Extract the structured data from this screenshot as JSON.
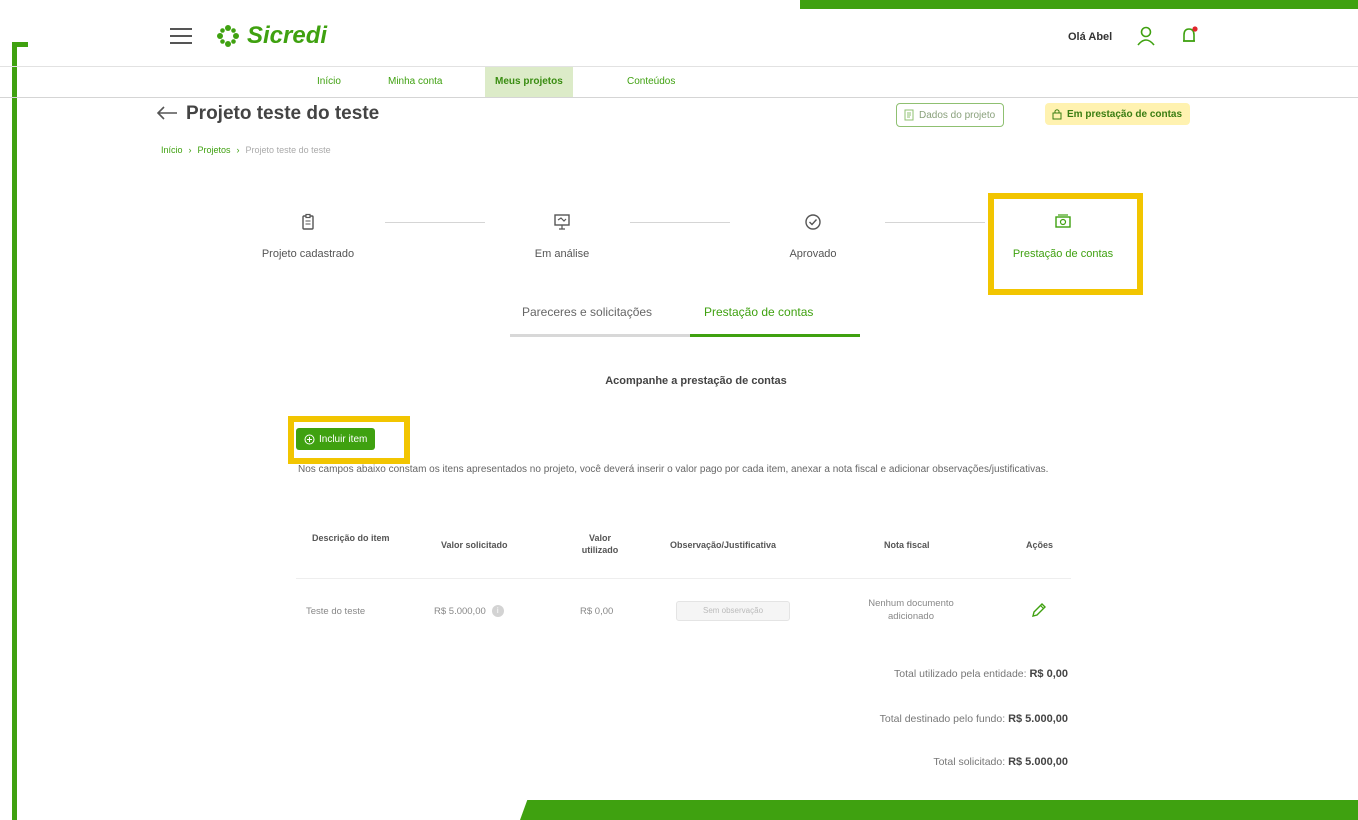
{
  "header": {
    "logo_text": "Sicredi",
    "greeting": "Olá Abel"
  },
  "nav": {
    "items": [
      {
        "label": "Início"
      },
      {
        "label": "Minha conta"
      },
      {
        "label": "Meus projetos",
        "active": true
      },
      {
        "label": "Conteúdos"
      }
    ]
  },
  "page": {
    "title": "Projeto teste do teste",
    "breadcrumb": [
      "Início",
      "Projetos",
      "Projeto teste do teste"
    ],
    "project_data_button": "Dados do projeto",
    "status": "Em prestação de contas"
  },
  "stepper": {
    "steps": [
      {
        "label": "Projeto cadastrado",
        "icon": "clipboard-icon"
      },
      {
        "label": "Em análise",
        "icon": "presentation-icon"
      },
      {
        "label": "Aprovado",
        "icon": "check-circle-icon"
      },
      {
        "label": "Prestação de contas",
        "icon": "money-icon"
      }
    ]
  },
  "tabs": [
    {
      "label": "Pareceres e solicitações"
    },
    {
      "label": "Prestação de contas",
      "active": true
    }
  ],
  "section_title": "Acompanhe a prestação de contas",
  "add_item_button": "Incluir item",
  "helper_text": "Nos campos abaixo constam os itens apresentados no projeto, você deverá inserir o valor pago por cada item, anexar a nota fiscal e adicionar observações/justificativas.",
  "table": {
    "headers": [
      "Descrição do item",
      "Valor solicitado",
      "Valor utilizado",
      "Observação/Justificativa",
      "Nota fiscal",
      "Ações"
    ],
    "rows": [
      {
        "description": "Teste do teste",
        "requested": "R$ 5.000,00",
        "used": "R$ 0,00",
        "observation": "Sem observação",
        "invoice": "Nenhum documento adicionado"
      }
    ]
  },
  "totals": {
    "used_label": "Total utilizado pela entidade:",
    "used_value": "R$ 0,00",
    "destined_label": "Total destinado pelo fundo:",
    "destined_value": "R$ 5.000,00",
    "requested_label": "Total solicitado:",
    "requested_value": "R$ 5.000,00"
  },
  "colors": {
    "brand_green": "#3fa110",
    "highlight_yellow": "#f2c500",
    "status_yellow": "#fff2b0"
  }
}
